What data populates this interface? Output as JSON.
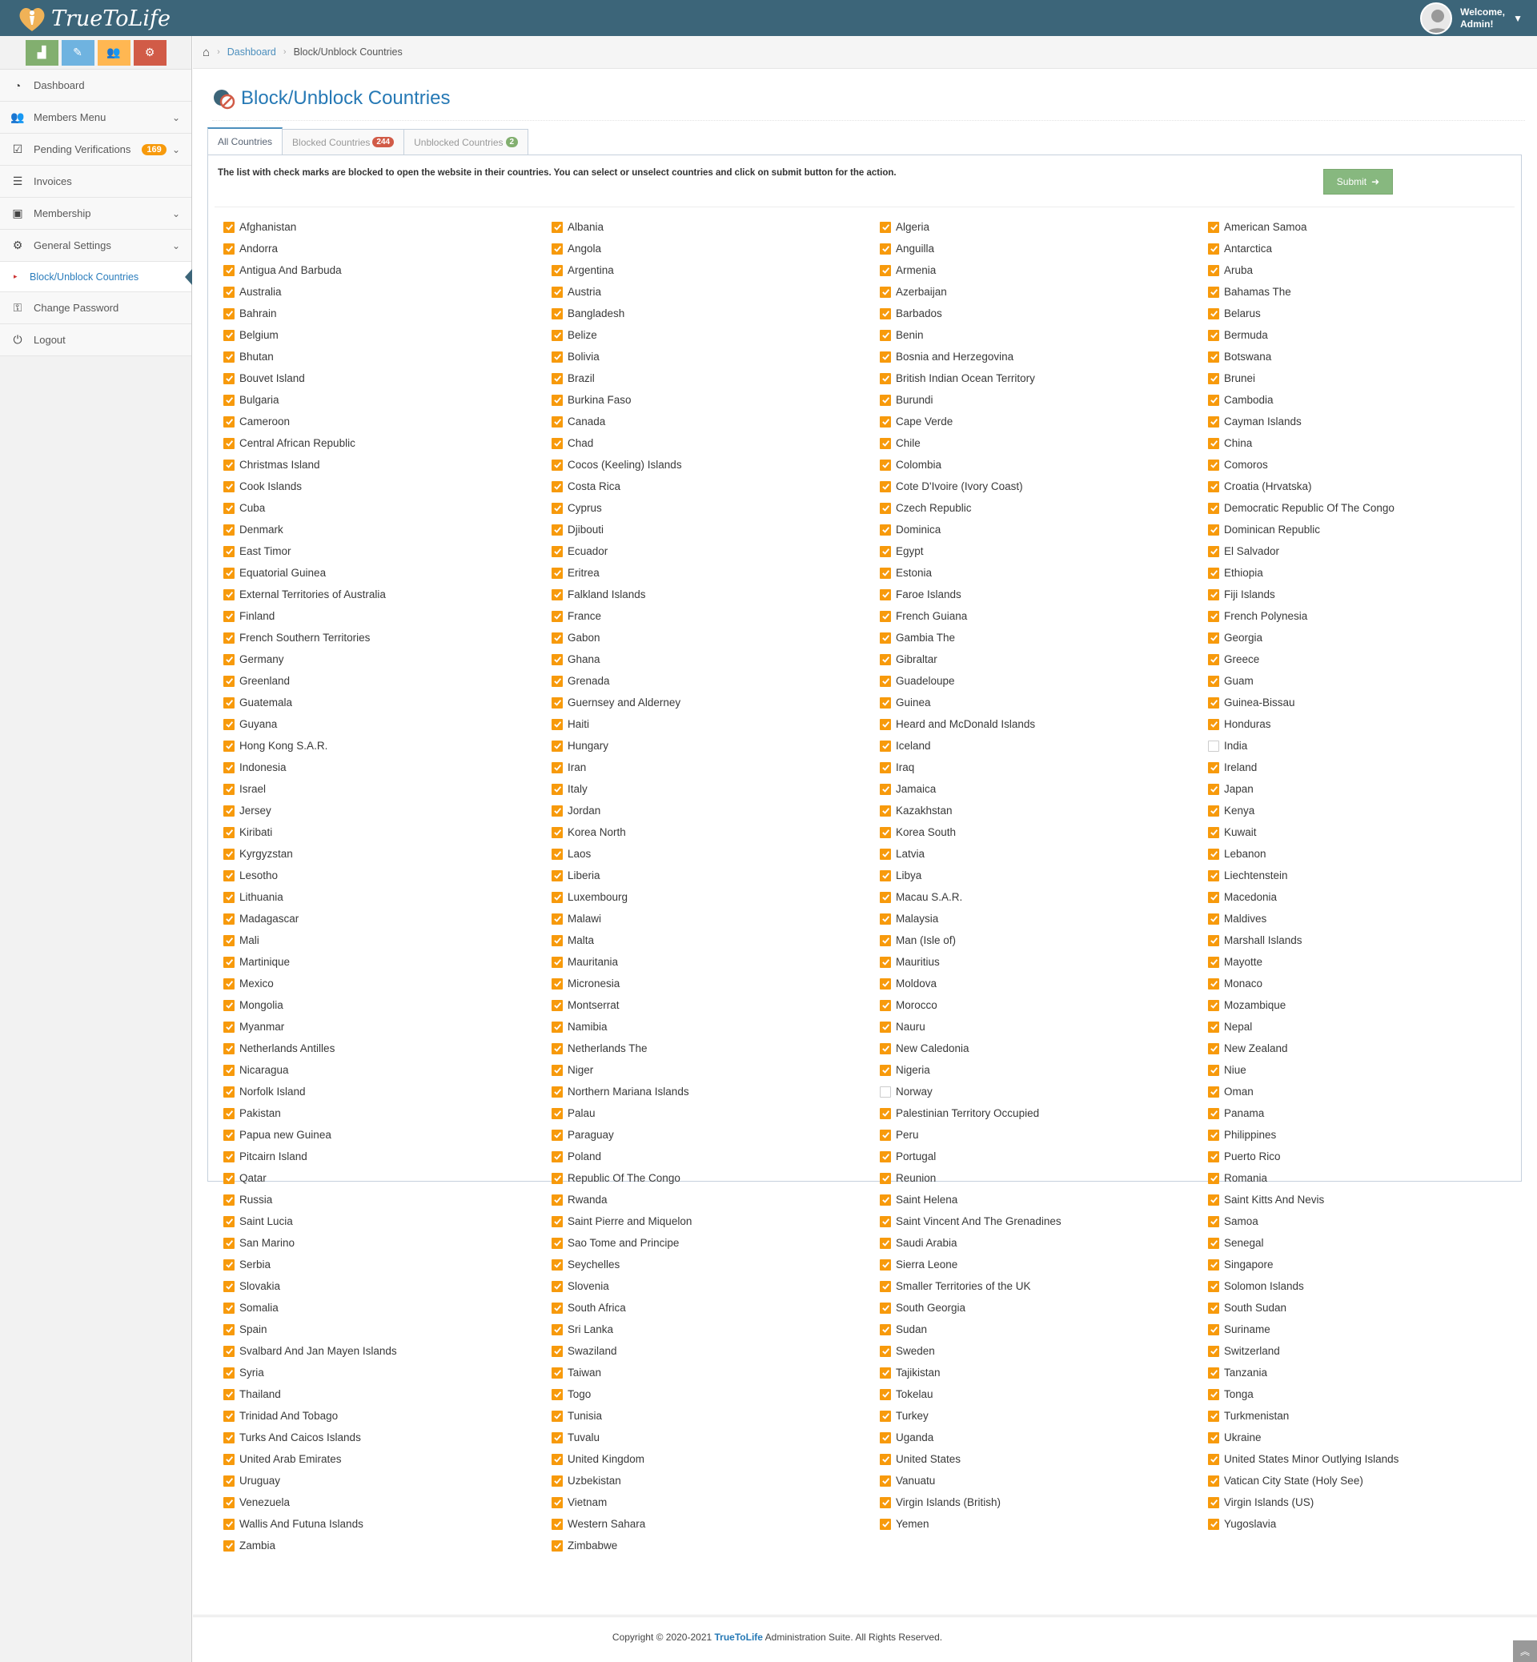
{
  "app": {
    "brand": "TrueToLife",
    "welcome_line1": "Welcome,",
    "welcome_line2": "Admin!"
  },
  "sidebar": {
    "items": [
      {
        "label": "Dashboard",
        "icon": "tachometer-icon"
      },
      {
        "label": "Members Menu",
        "icon": "users-icon"
      },
      {
        "label": "Pending Verifications",
        "icon": "check-square-icon",
        "badge": "169"
      },
      {
        "label": "Invoices",
        "icon": "list-icon"
      },
      {
        "label": "Membership",
        "icon": "money-icon"
      },
      {
        "label": "General Settings",
        "icon": "cogs-icon"
      }
    ],
    "subitem": "Block/Unblock Countries",
    "bottom_items": [
      {
        "label": "Change Password",
        "icon": "key-icon"
      },
      {
        "label": "Logout",
        "icon": "power-icon"
      }
    ]
  },
  "breadcrumb": {
    "home": "home-icon",
    "link": "Dashboard",
    "current": "Block/Unblock Countries"
  },
  "page": {
    "title": "Block/Unblock Countries"
  },
  "tabs": [
    {
      "label": "All Countries"
    },
    {
      "label": "Blocked Countries",
      "badge": "244",
      "badge_color": "#d15b47"
    },
    {
      "label": "Unblocked Countries",
      "badge": "2",
      "badge_color": "#82af6f"
    }
  ],
  "notice": "The list with check marks are blocked to open the website in their countries. You can select or unselect countries and click on submit button for the action.",
  "submit_label": "Submit",
  "unchecked": [
    "India",
    "Norway"
  ],
  "countries": [
    "Afghanistan",
    "Albania",
    "Algeria",
    "American Samoa",
    "Andorra",
    "Angola",
    "Anguilla",
    "Antarctica",
    "Antigua And Barbuda",
    "Argentina",
    "Armenia",
    "Aruba",
    "Australia",
    "Austria",
    "Azerbaijan",
    "Bahamas The",
    "Bahrain",
    "Bangladesh",
    "Barbados",
    "Belarus",
    "Belgium",
    "Belize",
    "Benin",
    "Bermuda",
    "Bhutan",
    "Bolivia",
    "Bosnia and Herzegovina",
    "Botswana",
    "Bouvet Island",
    "Brazil",
    "British Indian Ocean Territory",
    "Brunei",
    "Bulgaria",
    "Burkina Faso",
    "Burundi",
    "Cambodia",
    "Cameroon",
    "Canada",
    "Cape Verde",
    "Cayman Islands",
    "Central African Republic",
    "Chad",
    "Chile",
    "China",
    "Christmas Island",
    "Cocos (Keeling) Islands",
    "Colombia",
    "Comoros",
    "Cook Islands",
    "Costa Rica",
    "Cote D'Ivoire (Ivory Coast)",
    "Croatia (Hrvatska)",
    "Cuba",
    "Cyprus",
    "Czech Republic",
    "Democratic Republic Of The Congo",
    "Denmark",
    "Djibouti",
    "Dominica",
    "Dominican Republic",
    "East Timor",
    "Ecuador",
    "Egypt",
    "El Salvador",
    "Equatorial Guinea",
    "Eritrea",
    "Estonia",
    "Ethiopia",
    "External Territories of Australia",
    "Falkland Islands",
    "Faroe Islands",
    "Fiji Islands",
    "Finland",
    "France",
    "French Guiana",
    "French Polynesia",
    "French Southern Territories",
    "Gabon",
    "Gambia The",
    "Georgia",
    "Germany",
    "Ghana",
    "Gibraltar",
    "Greece",
    "Greenland",
    "Grenada",
    "Guadeloupe",
    "Guam",
    "Guatemala",
    "Guernsey and Alderney",
    "Guinea",
    "Guinea-Bissau",
    "Guyana",
    "Haiti",
    "Heard and McDonald Islands",
    "Honduras",
    "Hong Kong S.A.R.",
    "Hungary",
    "Iceland",
    "India",
    "Indonesia",
    "Iran",
    "Iraq",
    "Ireland",
    "Israel",
    "Italy",
    "Jamaica",
    "Japan",
    "Jersey",
    "Jordan",
    "Kazakhstan",
    "Kenya",
    "Kiribati",
    "Korea North",
    "Korea South",
    "Kuwait",
    "Kyrgyzstan",
    "Laos",
    "Latvia",
    "Lebanon",
    "Lesotho",
    "Liberia",
    "Libya",
    "Liechtenstein",
    "Lithuania",
    "Luxembourg",
    "Macau S.A.R.",
    "Macedonia",
    "Madagascar",
    "Malawi",
    "Malaysia",
    "Maldives",
    "Mali",
    "Malta",
    "Man (Isle of)",
    "Marshall Islands",
    "Martinique",
    "Mauritania",
    "Mauritius",
    "Mayotte",
    "Mexico",
    "Micronesia",
    "Moldova",
    "Monaco",
    "Mongolia",
    "Montserrat",
    "Morocco",
    "Mozambique",
    "Myanmar",
    "Namibia",
    "Nauru",
    "Nepal",
    "Netherlands Antilles",
    "Netherlands The",
    "New Caledonia",
    "New Zealand",
    "Nicaragua",
    "Niger",
    "Nigeria",
    "Niue",
    "Norfolk Island",
    "Northern Mariana Islands",
    "Norway",
    "Oman",
    "Pakistan",
    "Palau",
    "Palestinian Territory Occupied",
    "Panama",
    "Papua new Guinea",
    "Paraguay",
    "Peru",
    "Philippines",
    "Pitcairn Island",
    "Poland",
    "Portugal",
    "Puerto Rico",
    "Qatar",
    "Republic Of The Congo",
    "Reunion",
    "Romania",
    "Russia",
    "Rwanda",
    "Saint Helena",
    "Saint Kitts And Nevis",
    "Saint Lucia",
    "Saint Pierre and Miquelon",
    "Saint Vincent And The Grenadines",
    "Samoa",
    "San Marino",
    "Sao Tome and Principe",
    "Saudi Arabia",
    "Senegal",
    "Serbia",
    "Seychelles",
    "Sierra Leone",
    "Singapore",
    "Slovakia",
    "Slovenia",
    "Smaller Territories of the UK",
    "Solomon Islands",
    "Somalia",
    "South Africa",
    "South Georgia",
    "South Sudan",
    "Spain",
    "Sri Lanka",
    "Sudan",
    "Suriname",
    "Svalbard And Jan Mayen Islands",
    "Swaziland",
    "Sweden",
    "Switzerland",
    "Syria",
    "Taiwan",
    "Tajikistan",
    "Tanzania",
    "Thailand",
    "Togo",
    "Tokelau",
    "Tonga",
    "Trinidad And Tobago",
    "Tunisia",
    "Turkey",
    "Turkmenistan",
    "Turks And Caicos Islands",
    "Tuvalu",
    "Uganda",
    "Ukraine",
    "United Arab Emirates",
    "United Kingdom",
    "United States",
    "United States Minor Outlying Islands",
    "Uruguay",
    "Uzbekistan",
    "Vanuatu",
    "Vatican City State (Holy See)",
    "Venezuela",
    "Vietnam",
    "Virgin Islands (British)",
    "Virgin Islands (US)",
    "Wallis And Futuna Islands",
    "Western Sahara",
    "Yemen",
    "Yugoslavia",
    "Zambia",
    "Zimbabwe"
  ],
  "footer": {
    "prefix": "Copyright © 2020-2021 ",
    "brand": "TrueToLife",
    "suffix": " Administration Suite. All Rights Reserved."
  },
  "colors": {
    "topbar": "#3c6579",
    "checkbox": "#f79a0c",
    "link": "#2679b5",
    "submit": "#87b87f"
  }
}
